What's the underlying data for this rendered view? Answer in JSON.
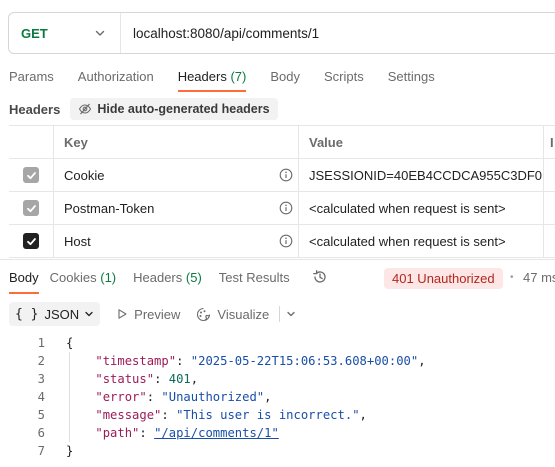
{
  "request": {
    "method": "GET",
    "url": "localhost:8080/api/comments/1"
  },
  "request_tabs": [
    {
      "label": "Params"
    },
    {
      "label": "Authorization"
    },
    {
      "label": "Headers",
      "count": "(7)",
      "active": true
    },
    {
      "label": "Body"
    },
    {
      "label": "Scripts"
    },
    {
      "label": "Settings"
    }
  ],
  "headers_section": {
    "title": "Headers",
    "hide_button_label": "Hide auto-generated headers"
  },
  "headers_table": {
    "columns": {
      "key": "Key",
      "value": "Value",
      "extra": "I"
    },
    "rows": [
      {
        "key": "Cookie",
        "value": "JSESSIONID=40EB4CCDCA955C3DF0...",
        "checked": true,
        "style": "auto"
      },
      {
        "key": "Postman-Token",
        "value": "<calculated when request is sent>",
        "checked": true,
        "style": "auto"
      },
      {
        "key": "Host",
        "value": "<calculated when request is sent>",
        "checked": true,
        "style": "dark"
      }
    ]
  },
  "response_tabs": [
    {
      "label": "Body",
      "active": true
    },
    {
      "label": "Cookies",
      "count": "(1)"
    },
    {
      "label": "Headers",
      "count": "(5)"
    },
    {
      "label": "Test Results"
    }
  ],
  "response_status": {
    "badge": "401 Unauthorized",
    "separator": "•",
    "time": "47 ms"
  },
  "format_bar": {
    "format_icon": "{ }",
    "format_label": "JSON",
    "preview_label": "Preview",
    "visualize_label": "Visualize"
  },
  "response_body": {
    "lines": [
      "1",
      "2",
      "3",
      "4",
      "5",
      "6",
      "7"
    ],
    "open_brace": "{",
    "close_brace": "}",
    "fields": [
      {
        "key": "\"timestamp\"",
        "value": "\"2025-05-22T15:06:53.608+00:00\"",
        "comma": ","
      },
      {
        "key": "\"status\"",
        "value": "401",
        "comma": ","
      },
      {
        "key": "\"error\"",
        "value": "\"Unauthorized\"",
        "comma": ","
      },
      {
        "key": "\"message\"",
        "value": "\"This user is incorrect.\"",
        "comma": ","
      },
      {
        "key": "\"path\"",
        "value": "\"/api/comments/1\"",
        "comma": ""
      }
    ]
  },
  "colors": {
    "accent": "#ff6c37",
    "method_get": "#0b7a42",
    "status_error_bg": "#fde6e6",
    "status_error_text": "#b3261e"
  }
}
